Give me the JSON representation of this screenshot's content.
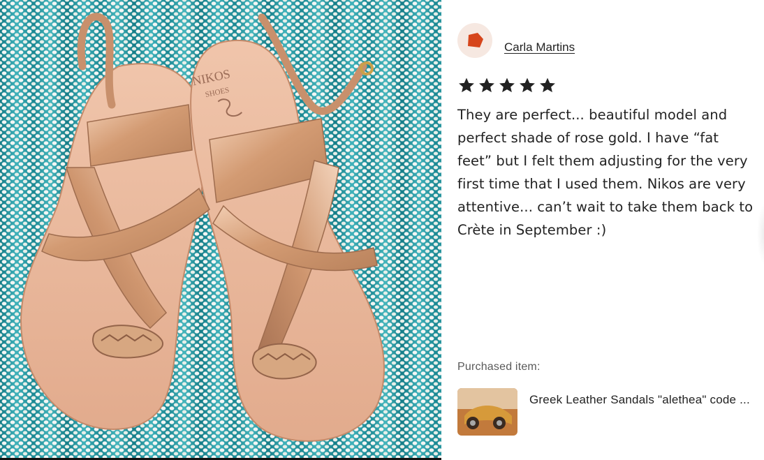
{
  "review": {
    "reviewer_name": "Carla Martins",
    "rating": 5,
    "rating_max": 5,
    "text": "They are perfect... beautiful model and\nperfect shade of rose gold. I have “fat\nfeet” but I felt them adjusting for the very\nfirst time that I used them. Nikos are very\nattentive... can’t wait to take them back to\nCrète in September :)"
  },
  "purchase": {
    "label": "Purchased item:",
    "item_title": "Greek Leather Sandals \"alethea\" code ..."
  },
  "photo": {
    "insole_logo_text": "NIKOS",
    "insole_logo_subtext": "SHOES"
  },
  "icons": {
    "avatar": "red-pentagon-avatar-icon",
    "star": "filled-star-icon"
  },
  "colors": {
    "star": "#222222",
    "avatar_bg": "#f6e8e1",
    "avatar_shape": "#d6451b",
    "text": "#222222",
    "muted_text": "#595959",
    "leather_sole": "#e8b79c",
    "rose_gold_strap": "#d9a57e"
  }
}
